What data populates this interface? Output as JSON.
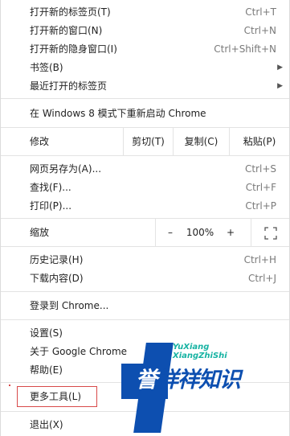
{
  "menu": {
    "items": [
      {
        "label": "打开新的标签页(T)",
        "shortcut": "Ctrl+T"
      },
      {
        "label": "打开新的窗口(N)",
        "shortcut": "Ctrl+N"
      },
      {
        "label": "打开新的隐身窗口(I)",
        "shortcut": "Ctrl+Shift+N"
      },
      {
        "label": "书签(B)",
        "shortcut": ""
      },
      {
        "label": "最近打开的标签页",
        "shortcut": ""
      }
    ],
    "relaunch": {
      "label": "在 Windows 8 模式下重新启动 Chrome"
    },
    "edit": {
      "label": "修改",
      "cut": "剪切(T)",
      "copy": "复制(C)",
      "paste": "粘贴(P)"
    },
    "page_items": [
      {
        "label": "网页另存为(A)...",
        "shortcut": "Ctrl+S"
      },
      {
        "label": "查找(F)...",
        "shortcut": "Ctrl+F"
      },
      {
        "label": "打印(P)...",
        "shortcut": "Ctrl+P"
      }
    ],
    "zoom": {
      "label": "缩放",
      "minus": "–",
      "value": "100%",
      "plus": "+"
    },
    "history_items": [
      {
        "label": "历史记录(H)",
        "shortcut": "Ctrl+H"
      },
      {
        "label": "下载内容(D)",
        "shortcut": "Ctrl+J"
      }
    ],
    "signin": {
      "label": "登录到 Chrome..."
    },
    "settings_items": [
      {
        "label": "设置(S)"
      },
      {
        "label": "关于 Google Chrome"
      },
      {
        "label": "帮助(E)"
      }
    ],
    "more_tools": {
      "label": "更多工具(L)"
    },
    "exit": {
      "label": "退出(X)"
    }
  },
  "watermark": {
    "top_line1": "YuXiang",
    "top_line2": "XiangZhiShi",
    "main_first": "誉",
    "main_rest": "祥祥知识"
  },
  "colors": {
    "highlight": "#d84a4a",
    "watermark_blue": "#0d4fb0",
    "watermark_teal": "#17b3a3"
  }
}
